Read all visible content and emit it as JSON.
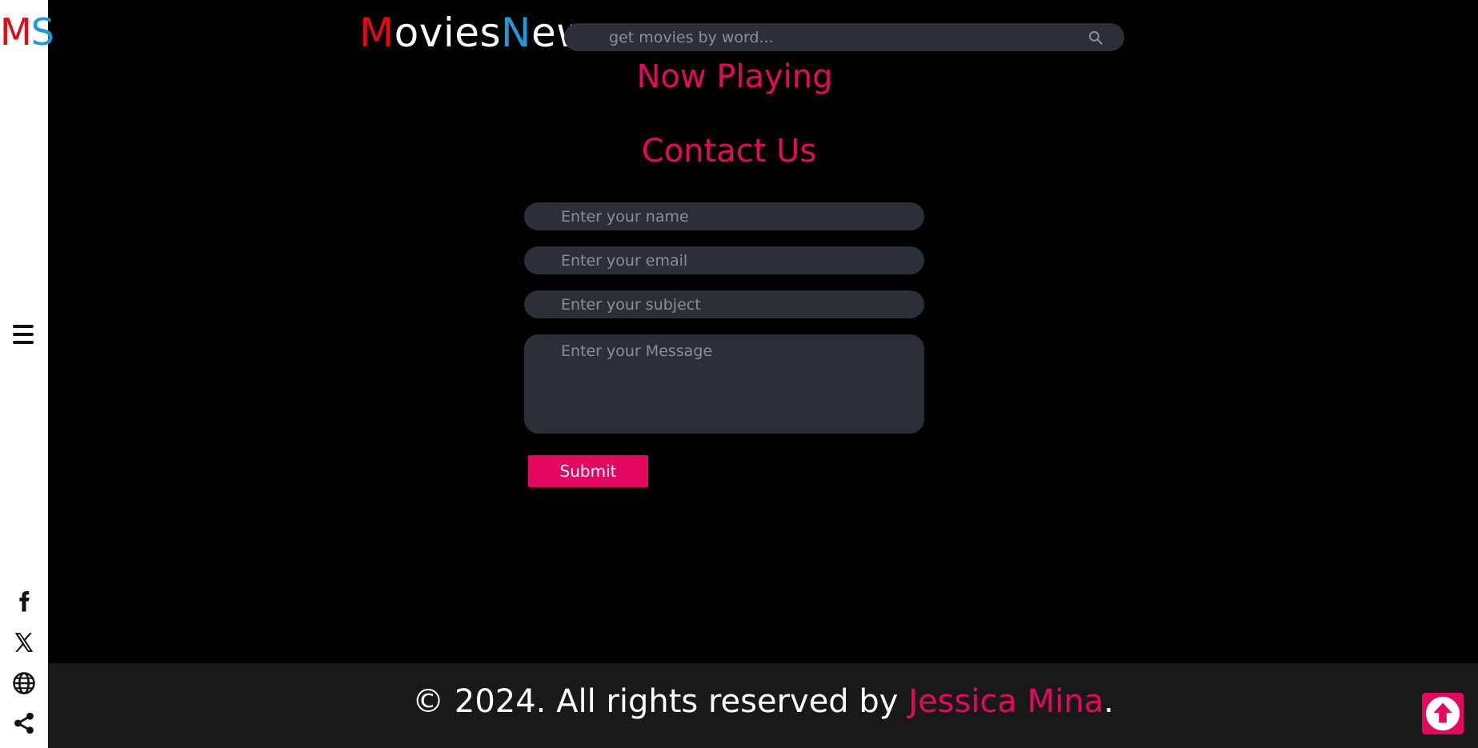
{
  "sidebar": {
    "logo_m": "M",
    "logo_s": "S",
    "menu_icon": "hamburger-icon",
    "social": [
      {
        "name": "facebook-icon"
      },
      {
        "name": "x-icon"
      },
      {
        "name": "globe-icon"
      },
      {
        "name": "share-icon"
      }
    ]
  },
  "header": {
    "brand_m": "M",
    "brand_ovies": "ovies",
    "brand_n": "N",
    "brand_ews": "ews",
    "search_placeholder": "get movies by word...",
    "search_icon": "search-icon"
  },
  "now_playing": {
    "title": "Now Playing"
  },
  "contact": {
    "title": "Contact Us",
    "name_placeholder": "Enter your name",
    "email_placeholder": "Enter your email",
    "subject_placeholder": "Enter your subject",
    "message_placeholder": "Enter your Message",
    "submit_label": "Submit"
  },
  "footer": {
    "prefix": "© 2024. All rights reserved by ",
    "author": "Jessica Mina",
    "suffix": "."
  },
  "colors": {
    "accent": "#e5085f",
    "brand_red": "#e50914",
    "brand_blue": "#1e9bd7",
    "input_bg": "#2b3038",
    "footer_bg": "#191919"
  }
}
